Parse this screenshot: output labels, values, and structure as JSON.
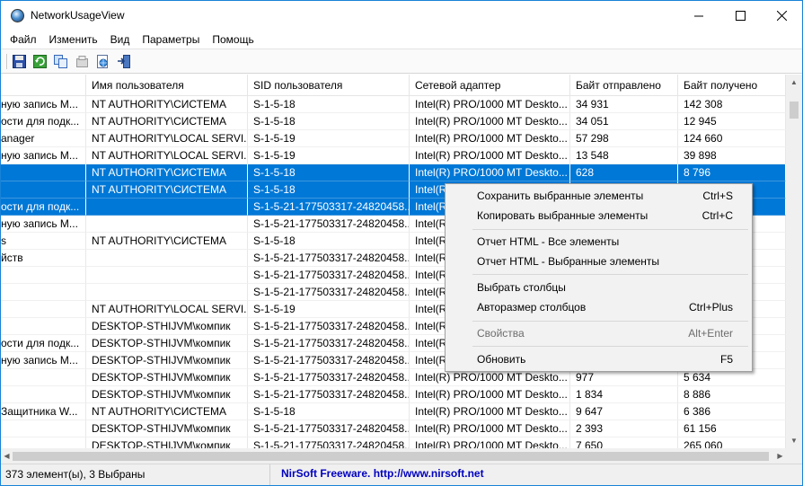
{
  "window": {
    "title": "NetworkUsageView",
    "minimize_glyph": "—",
    "maximize_glyph": "☐",
    "close_glyph": "✕"
  },
  "menu": [
    "Файл",
    "Изменить",
    "Вид",
    "Параметры",
    "Помощь"
  ],
  "toolbar": {
    "icons": [
      "save-icon",
      "refresh-icon",
      "copy-icon",
      "properties-icon",
      "html-report-icon",
      "exit-icon"
    ]
  },
  "table": {
    "columns": [
      "",
      "Имя пользователя",
      "SID пользователя",
      "Сетевой адаптер",
      "Байт отправлено",
      "Байт получено"
    ],
    "rows": [
      {
        "selected": false,
        "cells": [
          "ную запись М...",
          "NT AUTHORITY\\СИСТЕМА",
          "S-1-5-18",
          "Intel(R) PRO/1000 MT Deskto...",
          "34 931",
          "142 308"
        ]
      },
      {
        "selected": false,
        "cells": [
          "ости для подк...",
          "NT AUTHORITY\\СИСТЕМА",
          "S-1-5-18",
          "Intel(R) PRO/1000 MT Deskto...",
          "34 051",
          "12 945"
        ]
      },
      {
        "selected": false,
        "cells": [
          "anager",
          "NT AUTHORITY\\LOCAL SERVI...",
          "S-1-5-19",
          "Intel(R) PRO/1000 MT Deskto...",
          "57 298",
          "124 660"
        ]
      },
      {
        "selected": false,
        "cells": [
          "ную запись М...",
          "NT AUTHORITY\\LOCAL SERVI...",
          "S-1-5-19",
          "Intel(R) PRO/1000 MT Deskto...",
          "13 548",
          "39 898"
        ]
      },
      {
        "selected": true,
        "cells": [
          "",
          "NT AUTHORITY\\СИСТЕМА",
          "S-1-5-18",
          "Intel(R) PRO/1000 MT Deskto...",
          "628",
          "8 796"
        ]
      },
      {
        "selected": true,
        "cells": [
          "",
          "NT AUTHORITY\\СИСТЕМА",
          "S-1-5-18",
          "Intel(R",
          "",
          ""
        ]
      },
      {
        "selected": true,
        "cells": [
          "ости для подк...",
          "",
          "S-1-5-21-177503317-24820458...",
          "Intel(R",
          "",
          ""
        ]
      },
      {
        "selected": false,
        "cells": [
          "ную запись М...",
          "",
          "S-1-5-21-177503317-24820458...",
          "Intel(R",
          "",
          ""
        ]
      },
      {
        "selected": false,
        "cells": [
          "s",
          "NT AUTHORITY\\СИСТЕМА",
          "S-1-5-18",
          "Intel(R",
          "",
          ""
        ]
      },
      {
        "selected": false,
        "cells": [
          "йств",
          "",
          "S-1-5-21-177503317-24820458...",
          "Intel(R",
          "",
          ""
        ]
      },
      {
        "selected": false,
        "cells": [
          "",
          "",
          "S-1-5-21-177503317-24820458...",
          "Intel(R",
          "",
          ""
        ]
      },
      {
        "selected": false,
        "cells": [
          "",
          "",
          "S-1-5-21-177503317-24820458...",
          "Intel(R",
          "",
          ""
        ]
      },
      {
        "selected": false,
        "cells": [
          "",
          "NT AUTHORITY\\LOCAL SERVI...",
          "S-1-5-19",
          "Intel(R",
          "",
          ""
        ]
      },
      {
        "selected": false,
        "cells": [
          "",
          "DESKTOP-STHIJVM\\компик",
          "S-1-5-21-177503317-24820458...",
          "Intel(R",
          "",
          ""
        ]
      },
      {
        "selected": false,
        "cells": [
          "ости для подк...",
          "DESKTOP-STHIJVM\\компик",
          "S-1-5-21-177503317-24820458...",
          "Intel(R",
          "",
          ""
        ]
      },
      {
        "selected": false,
        "cells": [
          "ную запись М...",
          "DESKTOP-STHIJVM\\компик",
          "S-1-5-21-177503317-24820458...",
          "Intel(R",
          "",
          ""
        ]
      },
      {
        "selected": false,
        "cells": [
          "",
          "DESKTOP-STHIJVM\\компик",
          "S-1-5-21-177503317-24820458...",
          "Intel(R) PRO/1000 MT Deskto...",
          "977",
          "5 634"
        ]
      },
      {
        "selected": false,
        "cells": [
          "",
          "DESKTOP-STHIJVM\\компик",
          "S-1-5-21-177503317-24820458...",
          "Intel(R) PRO/1000 MT Deskto...",
          "1 834",
          "8 886"
        ]
      },
      {
        "selected": false,
        "cells": [
          "Защитника W...",
          "NT AUTHORITY\\СИСТЕМА",
          "S-1-5-18",
          "Intel(R) PRO/1000 MT Deskto...",
          "9 647",
          "6 386"
        ]
      },
      {
        "selected": false,
        "cells": [
          "",
          "DESKTOP-STHIJVM\\компик",
          "S-1-5-21-177503317-24820458...",
          "Intel(R) PRO/1000 MT Deskto...",
          "2 393",
          "61 156"
        ]
      },
      {
        "selected": false,
        "cells": [
          "",
          "DESKTOP-STHIJVM\\компик",
          "S-1-5-21-177503317-24820458...",
          "Intel(R) PRO/1000 MT Deskto...",
          "7 650",
          "265 060"
        ]
      }
    ]
  },
  "context_menu": {
    "items": [
      {
        "label": "Сохранить выбранные элементы",
        "shortcut": "Ctrl+S",
        "disabled": false
      },
      {
        "label": "Копировать выбранные элементы",
        "shortcut": "Ctrl+C",
        "disabled": false
      },
      {
        "label": "Отчет HTML - Все элементы",
        "shortcut": "",
        "disabled": false
      },
      {
        "label": "Отчет HTML - Выбранные элементы",
        "shortcut": "",
        "disabled": false
      },
      {
        "label": "Выбрать столбцы",
        "shortcut": "",
        "disabled": false
      },
      {
        "label": "Авторазмер столбцов",
        "shortcut": "Ctrl+Plus",
        "disabled": false
      },
      {
        "label": "Свойства",
        "shortcut": "Alt+Enter",
        "disabled": true
      },
      {
        "label": "Обновить",
        "shortcut": "F5",
        "disabled": false
      }
    ]
  },
  "status": {
    "count_text": "373 элемент(ы), 3 Выбраны",
    "link_text": "NirSoft Freeware.  http://www.nirsoft.net"
  },
  "colors": {
    "selection": "#0078d7",
    "link": "#0000c0",
    "window_border": "#1883d7"
  }
}
